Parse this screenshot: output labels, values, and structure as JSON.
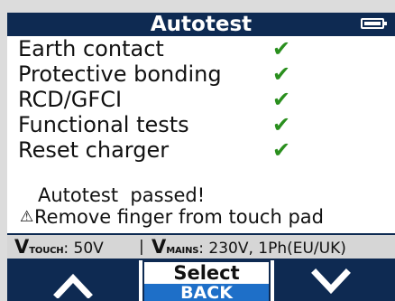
{
  "header": {
    "title": "Autotest",
    "battery_icon": "battery-full-icon"
  },
  "tests": [
    {
      "label": "Earth contact",
      "result_icon": "checkmark-icon"
    },
    {
      "label": "Protective bonding",
      "result_icon": "checkmark-icon"
    },
    {
      "label": "RCD/GFCI",
      "result_icon": "checkmark-icon"
    },
    {
      "label": "Functional tests",
      "result_icon": "checkmark-icon"
    },
    {
      "label": "Reset charger",
      "result_icon": "checkmark-icon"
    }
  ],
  "check_symbol": "✔",
  "message": {
    "icon": "warning-triangle-icon",
    "icon_symbol": "⚠",
    "line1": "Autotest  passed!",
    "line2": "Remove finger from touch pad"
  },
  "status": {
    "vtouch_v": "V",
    "vtouch_sub": "TOUCH",
    "vtouch_value": ": 50V",
    "separator": "|",
    "vmains_v": "V",
    "vmains_sub": "MAINS",
    "vmains_value": ": 230V, 1Ph(EU/UK)"
  },
  "buttons": {
    "up_icon": "chevron-up-icon",
    "select_label": "Select",
    "back_label": "BACK",
    "down_icon": "chevron-down-icon"
  },
  "colors": {
    "header_bg": "#0e2a52",
    "check": "#2a8f1e",
    "back_bg": "#1e6fc8",
    "status_bg": "#d6d6d6"
  }
}
